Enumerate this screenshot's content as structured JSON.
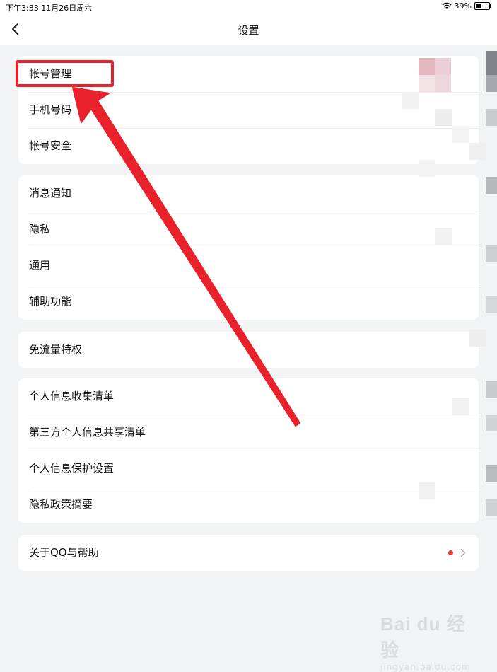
{
  "status_bar": {
    "time": "下午3:33  11月26日周六",
    "battery": "39%"
  },
  "navbar": {
    "title": "设置",
    "back_icon": "chevron-left-icon"
  },
  "sections": [
    {
      "items": [
        {
          "label": "帐号管理"
        },
        {
          "label": "手机号码"
        },
        {
          "label": "帐号安全"
        }
      ]
    },
    {
      "items": [
        {
          "label": "消息通知"
        },
        {
          "label": "隐私"
        },
        {
          "label": "通用"
        },
        {
          "label": "辅助功能"
        }
      ]
    },
    {
      "items": [
        {
          "label": "免流量特权"
        }
      ]
    },
    {
      "items": [
        {
          "label": "个人信息收集清单"
        },
        {
          "label": "第三方个人信息共享清单"
        },
        {
          "label": "个人信息保护设置"
        },
        {
          "label": "隐私政策摘要"
        }
      ]
    },
    {
      "items": [
        {
          "label": "关于QQ与帮助",
          "badge_dot": true,
          "chevron": "chevron-right-icon"
        }
      ]
    }
  ],
  "annotation": {
    "highlight_color": "#e8212a",
    "target": "帐号管理"
  },
  "watermark": {
    "brand": "Bai du 经验",
    "sub": "jingyan.baidu.com"
  },
  "colors": {
    "background": "#f2f3f5",
    "badge": "#e94434"
  }
}
